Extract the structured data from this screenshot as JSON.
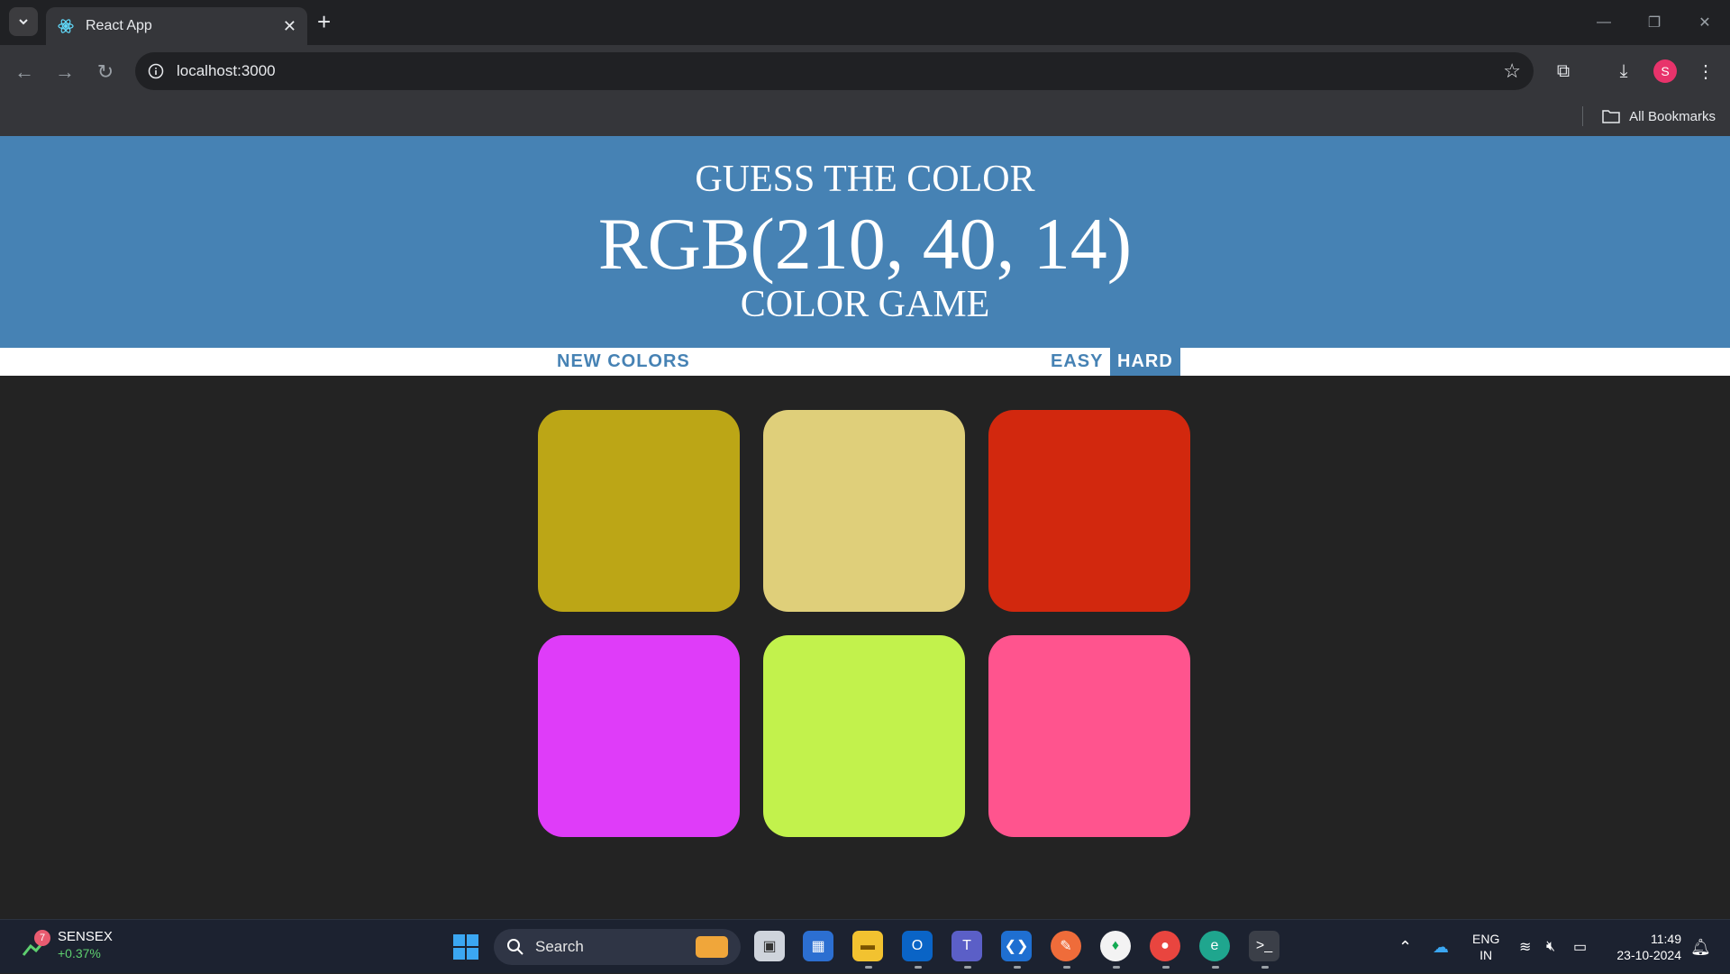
{
  "browser": {
    "tab_title": "React App",
    "url": "localhost:3000",
    "bookmarks_label": "All Bookmarks",
    "profile_initial": "S"
  },
  "game": {
    "header_line1": "GUESS THE COLOR",
    "target_color": "RGB(210, 40, 14)",
    "header_line3": "COLOR GAME",
    "header_color": "#4682b4",
    "new_colors_label": "NEW COLORS",
    "easy_label": "EASY",
    "hard_label": "HARD",
    "selected_mode": "HARD",
    "squares": [
      {
        "color": "#bca616"
      },
      {
        "color": "#dfcf7a"
      },
      {
        "color": "#d2280e"
      },
      {
        "color": "#df3cf9"
      },
      {
        "color": "#c2f24c"
      },
      {
        "color": "#ff548e"
      }
    ]
  },
  "taskbar": {
    "widget_name": "SENSEX",
    "widget_change": "+0.37%",
    "widget_badge": "7",
    "search_label": "Search",
    "language_line1": "ENG",
    "language_line2": "IN",
    "time": "11:49",
    "date": "23-10-2024"
  }
}
